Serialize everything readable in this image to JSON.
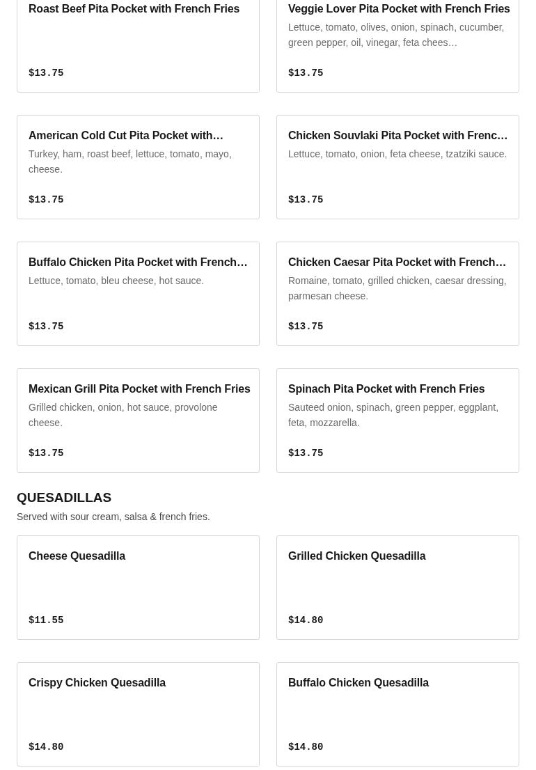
{
  "sections": [
    {
      "items": [
        {
          "name": "Roast Beef Pita Pocket with French Fries",
          "price": "$13.75"
        },
        {
          "name": "Veggie Lover Pita Pocket with French Fries",
          "description": "Lettuce, tomato, olives, onion, spinach, cucumber, green pepper, oil, vinegar, feta chees…",
          "price": "$13.75"
        },
        {
          "name": "American Cold Cut Pita Pocket with…",
          "description": "Turkey, ham, roast beef, lettuce, tomato, mayo, cheese.",
          "price": "$13.75"
        },
        {
          "name": "Chicken Souvlaki Pita Pocket with Frenc…",
          "description": "Lettuce, tomato, onion, feta cheese, tzatziki sauce.",
          "price": "$13.75"
        },
        {
          "name": "Buffalo Chicken Pita Pocket with French…",
          "description": "Lettuce, tomato, bleu cheese, hot sauce.",
          "price": "$13.75"
        },
        {
          "name": "Chicken Caesar Pita Pocket with French…",
          "description": "Romaine, tomato, grilled chicken, caesar dressing, parmesan cheese.",
          "price": "$13.75"
        },
        {
          "name": "Mexican Grill Pita Pocket with French Fries",
          "description": "Grilled chicken, onion, hot sauce, provolone cheese.",
          "price": "$13.75"
        },
        {
          "name": "Spinach Pita Pocket with French Fries",
          "description": "Sauteed onion, spinach, green pepper, eggplant, feta, mozzarella.",
          "price": "$13.75"
        }
      ]
    },
    {
      "title": "QUESADILLAS",
      "subtitle": "Served with sour cream, salsa & french fries.",
      "items": [
        {
          "name": "Cheese Quesadilla",
          "price": "$11.55"
        },
        {
          "name": "Grilled Chicken Quesadilla",
          "price": "$14.80"
        },
        {
          "name": "Crispy Chicken Quesadilla",
          "price": "$14.80"
        },
        {
          "name": "Buffalo Chicken Quesadilla",
          "price": "$14.80"
        }
      ]
    }
  ]
}
